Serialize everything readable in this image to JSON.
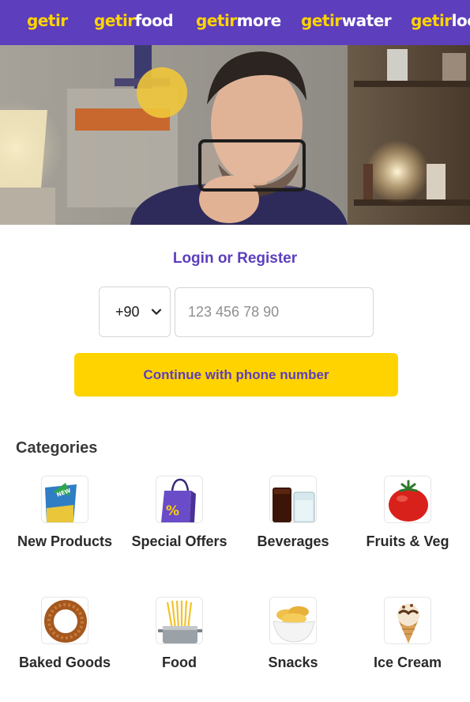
{
  "brands": [
    {
      "prefix": "getir",
      "suffix": ""
    },
    {
      "prefix": "getir",
      "suffix": "food"
    },
    {
      "prefix": "getir",
      "suffix": "more"
    },
    {
      "prefix": "getir",
      "suffix": "water"
    },
    {
      "prefix": "getir",
      "suffix": "loc"
    }
  ],
  "login": {
    "title": "Login or Register",
    "country_code": "+90",
    "phone_placeholder": "123 456 78 90",
    "continue_label": "Continue with phone number"
  },
  "categories": {
    "title": "Categories",
    "items": [
      {
        "label": "New Products",
        "icon": "new-products-icon"
      },
      {
        "label": "Special Offers",
        "icon": "special-offers-icon"
      },
      {
        "label": "Beverages",
        "icon": "beverages-icon"
      },
      {
        "label": "Fruits & Veg",
        "icon": "fruits-veg-icon"
      },
      {
        "label": "Baked Goods",
        "icon": "baked-goods-icon"
      },
      {
        "label": "Food",
        "icon": "food-icon"
      },
      {
        "label": "Snacks",
        "icon": "snacks-icon"
      },
      {
        "label": "Ice Cream",
        "icon": "ice-cream-icon"
      }
    ]
  },
  "colors": {
    "brand_purple": "#5d3ebc",
    "brand_yellow": "#ffd300"
  },
  "icons": {
    "new_badge": "NEW",
    "offer_symbol": "%"
  }
}
